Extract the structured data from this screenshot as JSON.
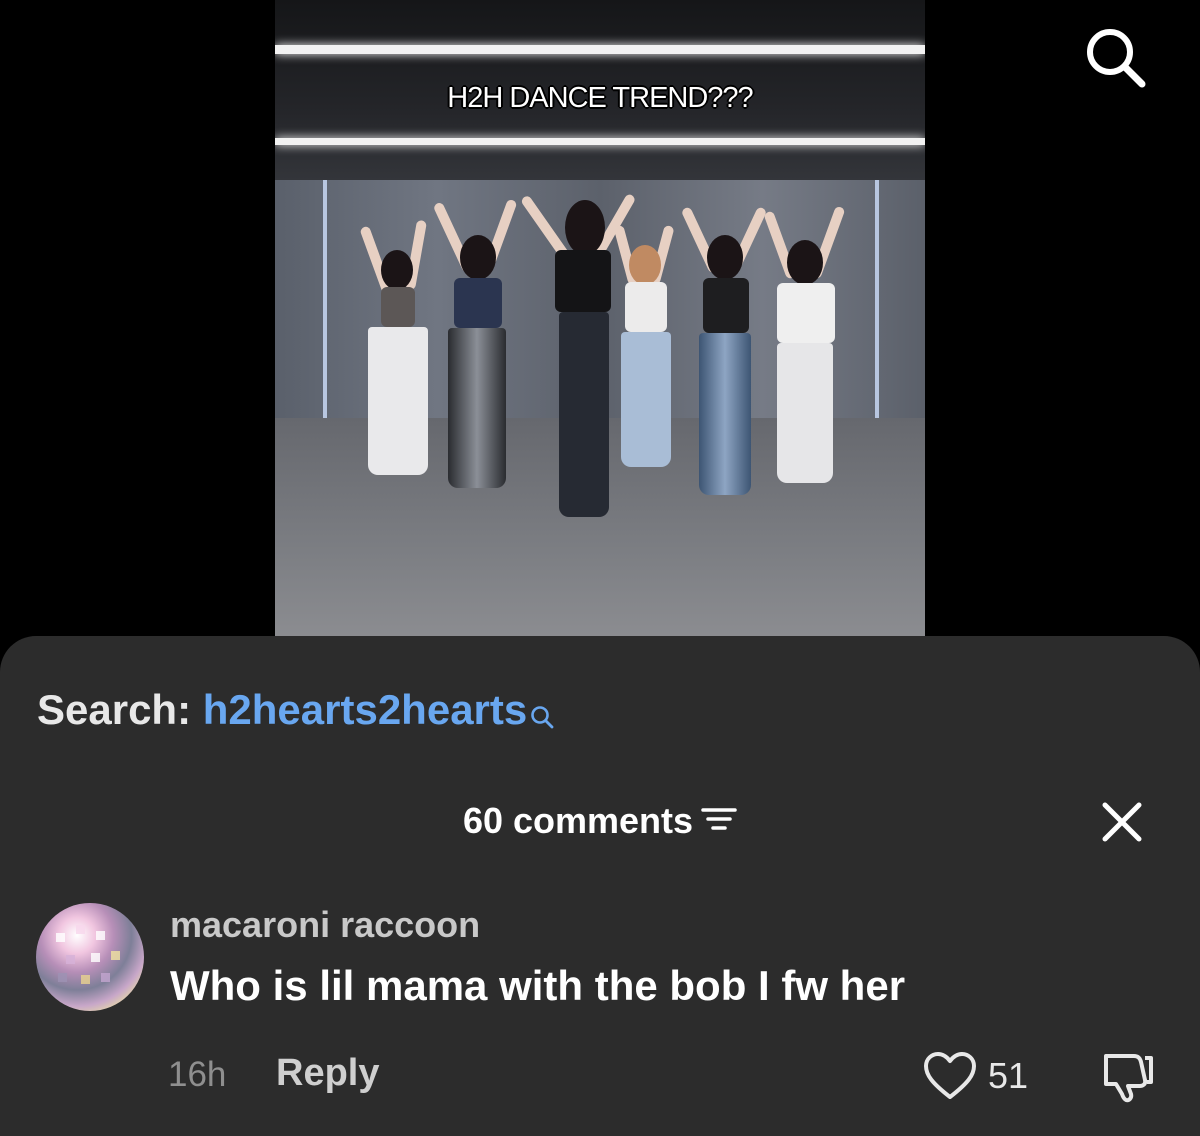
{
  "video": {
    "caption": "H2H DANCE TREND???"
  },
  "header": {
    "search_icon": "search-icon"
  },
  "search_suggestion": {
    "prefix": "Search:",
    "term": "h2hearts2hearts",
    "icon": "search-icon",
    "color": "#69a7f0"
  },
  "comments_panel": {
    "count_label": "60 comments",
    "sort_icon": "sort-filter-icon",
    "close_icon": "close-icon",
    "background": "#2c2c2c"
  },
  "comments": [
    {
      "username": "macaroni raccoon",
      "text": "Who is lil mama with the bob I fw her",
      "time": "16h",
      "reply_label": "Reply",
      "likes": "51",
      "like_icon": "heart-outline-icon",
      "dislike_icon": "thumbs-down-icon"
    }
  ]
}
